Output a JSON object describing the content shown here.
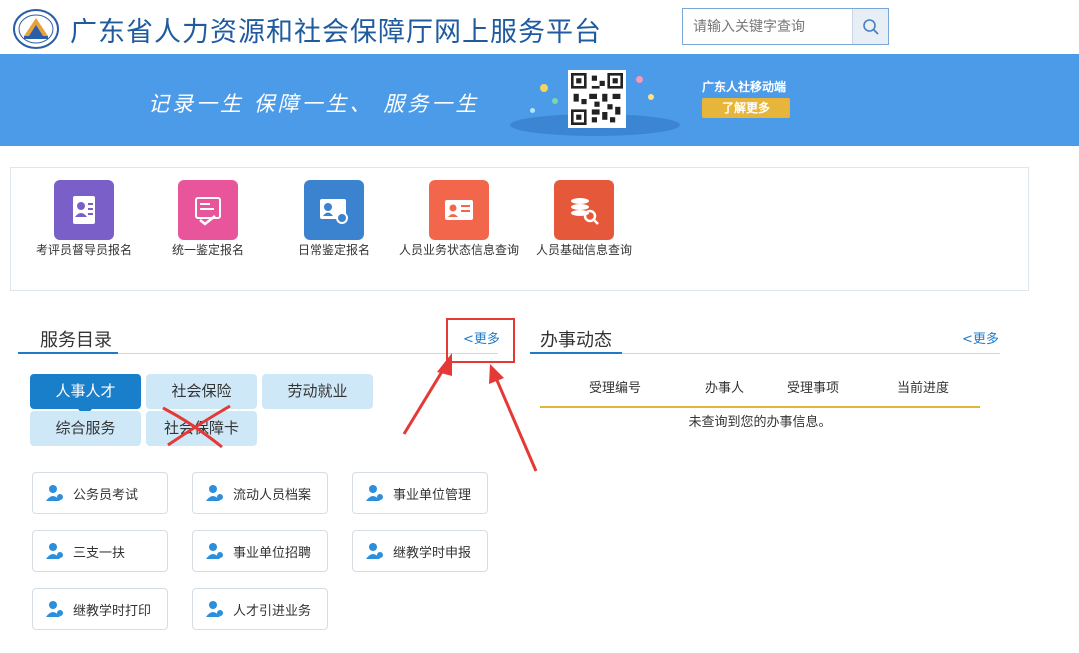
{
  "header": {
    "title": "广东省人力资源和社会保障厅网上服务平台",
    "search": {
      "placeholder": "请输入关键字查询",
      "value": ""
    }
  },
  "banner": {
    "slogan": "记录一生  保障一生、 服务一生",
    "mobile_label": "广东人社移动端",
    "learn_more_label": "了解更多"
  },
  "quick_services": [
    {
      "label": "考评员督导员报名",
      "icon": "id-card-person-icon",
      "color": "#7a5fc9"
    },
    {
      "label": "统一鉴定报名",
      "icon": "certificate-icon",
      "color": "#e9559b"
    },
    {
      "label": "日常鉴定报名",
      "icon": "badge-icon",
      "color": "#3b83cf"
    },
    {
      "label": "人员业务状态信息查询",
      "icon": "person-card-icon",
      "color": "#f2674b"
    },
    {
      "label": "人员基础信息查询",
      "icon": "search-records-icon",
      "color": "#e5593a"
    }
  ],
  "service_catalog": {
    "title": "服务目录",
    "more_label": "<更多",
    "tabs": [
      {
        "label": "人事人才",
        "active": true
      },
      {
        "label": "社会保险",
        "active": false
      },
      {
        "label": "劳动就业",
        "active": false
      },
      {
        "label": "综合服务",
        "active": false
      },
      {
        "label": "社会保障卡",
        "active": false
      }
    ],
    "services": [
      "公务员考试",
      "流动人员档案",
      "事业单位管理",
      "三支一扶",
      "事业单位招聘",
      "继教学时申报",
      "继教学时打印",
      "人才引进业务"
    ]
  },
  "dynamics": {
    "title": "办事动态",
    "more_label": "<更多",
    "columns": [
      "受理编号",
      "办事人",
      "受理事项",
      "当前进度"
    ],
    "empty_message": "未查询到您的办事信息。"
  },
  "colors": {
    "banner": "#4c9be9",
    "accent": "#1a7fcb",
    "tab_inactive": "#cfe8f8",
    "annotation": "#e53935",
    "gold": "#e2b43a"
  }
}
